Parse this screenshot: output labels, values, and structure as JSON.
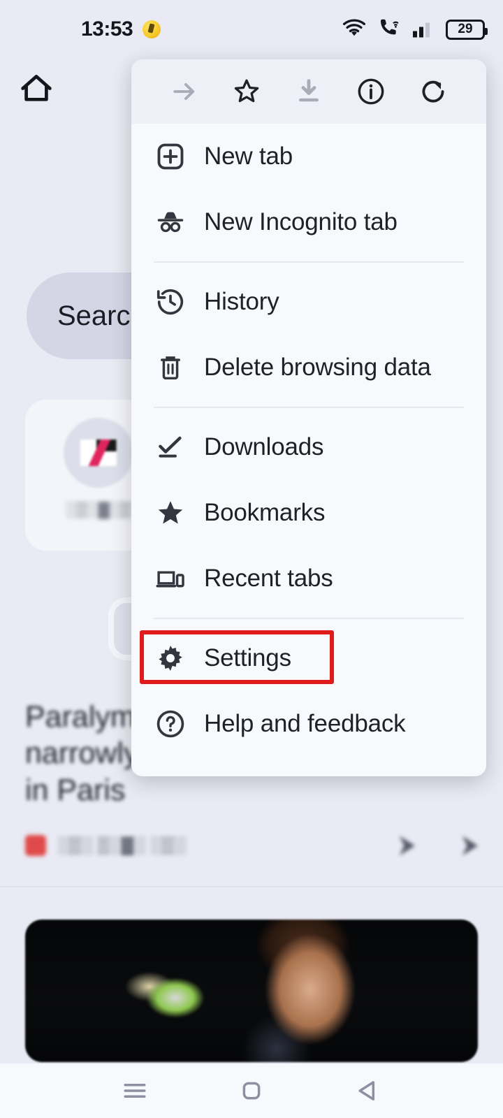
{
  "status_bar": {
    "time": "13:53",
    "emoji_icon": "alarm-emoji-icon",
    "wifi_icon": "wifi-icon",
    "call_icon": "wifi-calling-icon",
    "signal_icon": "cellular-signal-icon",
    "battery_level": "29"
  },
  "background_page": {
    "home_icon": "home-icon",
    "search_pill_text": "Search",
    "shortcut_tile_label": "░▒░▓░▒",
    "news_headline": "Paralympic archer Sh... narrowly misses world record in Paris",
    "news_byline": "░▒░ ▒░▓░ ░▒░"
  },
  "menu": {
    "header_actions": [
      {
        "name": "forward-arrow-icon",
        "label": "Forward",
        "disabled": true
      },
      {
        "name": "star-outline-icon",
        "label": "Bookmark this page",
        "disabled": false
      },
      {
        "name": "download-icon",
        "label": "Download page",
        "disabled": true
      },
      {
        "name": "info-circle-icon",
        "label": "Page info",
        "disabled": false
      },
      {
        "name": "reload-icon",
        "label": "Reload",
        "disabled": false
      }
    ],
    "groups": [
      {
        "items": [
          {
            "icon": "new-tab-icon",
            "label": "New tab"
          },
          {
            "icon": "incognito-icon",
            "label": "New Incognito tab"
          }
        ]
      },
      {
        "items": [
          {
            "icon": "history-icon",
            "label": "History"
          },
          {
            "icon": "trash-icon",
            "label": "Delete browsing data"
          }
        ]
      },
      {
        "items": [
          {
            "icon": "downloads-check-icon",
            "label": "Downloads"
          },
          {
            "icon": "star-filled-icon",
            "label": "Bookmarks"
          },
          {
            "icon": "recent-tabs-icon",
            "label": "Recent tabs"
          }
        ]
      },
      {
        "items": [
          {
            "icon": "gear-icon",
            "label": "Settings",
            "highlighted": true
          },
          {
            "icon": "help-circle-icon",
            "label": "Help and feedback"
          }
        ]
      }
    ],
    "highlight_color": "#e01b1b"
  },
  "nav_bar": {
    "recents_icon": "recents-icon",
    "home_icon": "home-square-icon",
    "back_icon": "back-triangle-icon"
  }
}
